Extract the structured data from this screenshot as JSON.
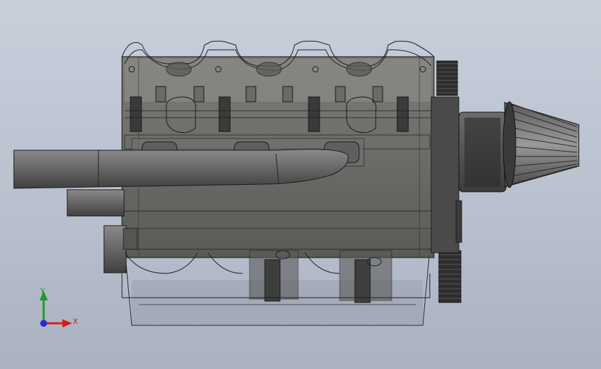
{
  "scene": {
    "model_name": "",
    "background_top": "#c9cfdb",
    "background_bottom": "#aab2c2"
  },
  "triad": {
    "x_label": "X",
    "y_label": "Y",
    "x_color": "#d0201c",
    "y_color": "#1f9a2a",
    "z_color": "#2a2ad0"
  }
}
